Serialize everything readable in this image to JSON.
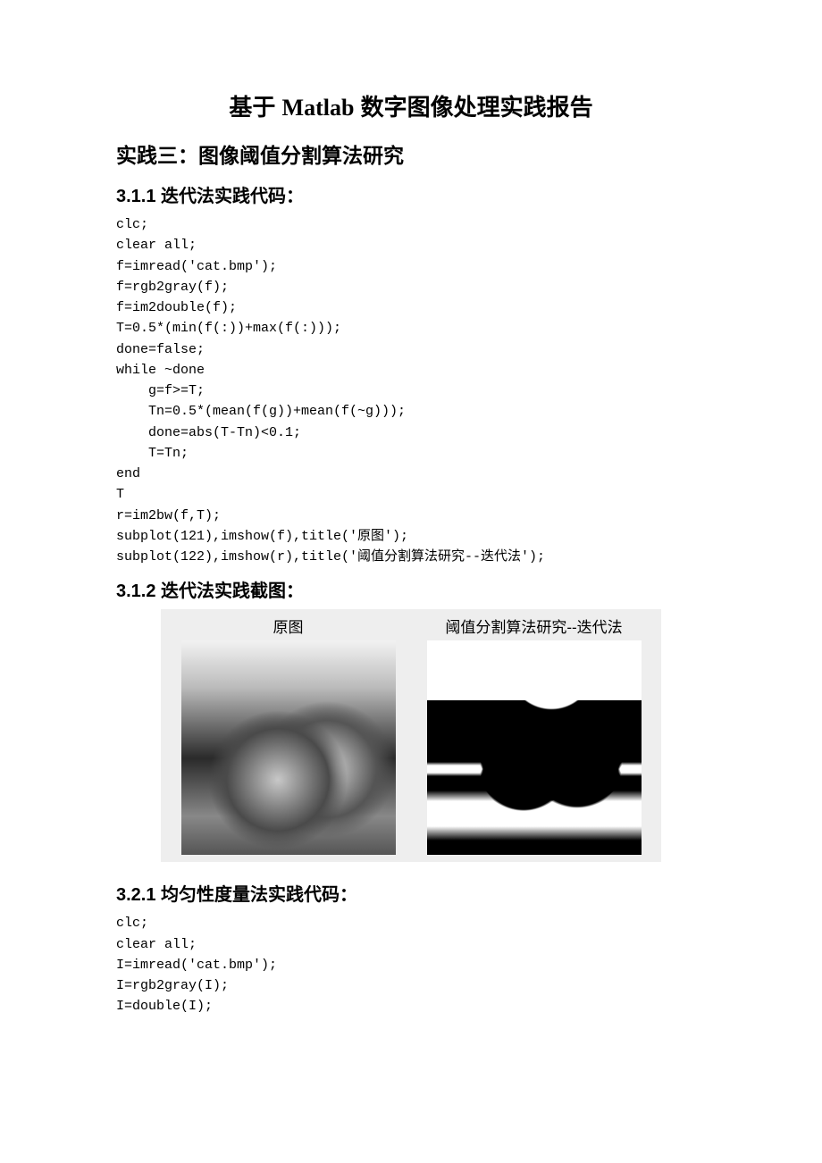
{
  "title_prefix": "基于 ",
  "title_latin": "Matlab",
  "title_suffix": " 数字图像处理实践报告",
  "section_title": "实践三：图像阈值分割算法研究",
  "sub311_title": "3.1.1 迭代法实践代码：",
  "code311": "clc;\nclear all;\nf=imread('cat.bmp');\nf=rgb2gray(f);\nf=im2double(f);\nT=0.5*(min(f(:))+max(f(:)));\ndone=false;\nwhile ~done\n    g=f>=T;\n    Tn=0.5*(mean(f(g))+mean(f(~g)));\n    done=abs(T-Tn)<0.1;\n    T=Tn;\nend\nT\nr=im2bw(f,T);\nsubplot(121),imshow(f),title('原图');\nsubplot(122),imshow(r),title('阈值分割算法研究--迭代法');",
  "sub312_title": "3.1.2 迭代法实践截图：",
  "figure": {
    "left_caption": "原图",
    "right_caption": "阈值分割算法研究--迭代法"
  },
  "sub321_title": "3.2.1 均匀性度量法实践代码：",
  "code321": "clc;\nclear all;\nI=imread('cat.bmp');\nI=rgb2gray(I);\nI=double(I);"
}
